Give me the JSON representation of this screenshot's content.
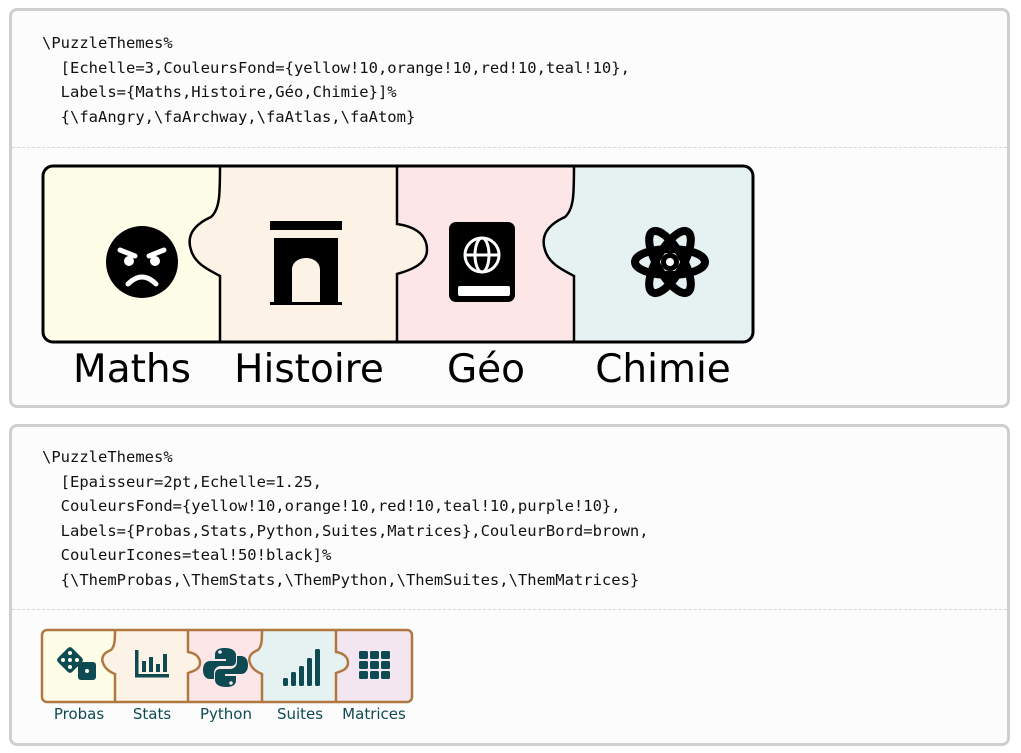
{
  "example1": {
    "code_lines": [
      "\\PuzzleThemes%",
      "  [Echelle=3,CouleursFond={yellow!10,orange!10,red!10,teal!10},",
      "  Labels={Maths,Histoire,Géo,Chimie}]%",
      "  {\\faAngry,\\faArchway,\\faAtlas,\\faAtom}"
    ],
    "pieces": [
      {
        "label": "Maths",
        "icon": "angry-face-icon",
        "fill": "#fefde8"
      },
      {
        "label": "Histoire",
        "icon": "archway-icon",
        "fill": "#fdf2e6"
      },
      {
        "label": "Géo",
        "icon": "atlas-icon",
        "fill": "#fde6e8"
      },
      {
        "label": "Chimie",
        "icon": "atom-icon",
        "fill": "#e6f2f2"
      }
    ],
    "border_color": "#000000",
    "icon_color": "#000000"
  },
  "example2": {
    "code_lines": [
      "\\PuzzleThemes%",
      "  [Epaisseur=2pt,Echelle=1.25,",
      "  CouleursFond={yellow!10,orange!10,red!10,teal!10,purple!10},",
      "  Labels={Probas,Stats,Python,Suites,Matrices},CouleurBord=brown,",
      "  CouleurIcones=teal!50!black]%",
      "  {\\ThemProbas,\\ThemStats,\\ThemPython,\\ThemSuites,\\ThemMatrices}"
    ],
    "pieces": [
      {
        "label": "Probas",
        "icon": "dice-icon",
        "fill": "#fefde8"
      },
      {
        "label": "Stats",
        "icon": "bar-chart-icon",
        "fill": "#fdf2e6"
      },
      {
        "label": "Python",
        "icon": "python-icon",
        "fill": "#fde6e8"
      },
      {
        "label": "Suites",
        "icon": "signal-bars-icon",
        "fill": "#e6f2f2"
      },
      {
        "label": "Matrices",
        "icon": "grid-icon",
        "fill": "#f4e6f0"
      }
    ],
    "border_color": "#b07840",
    "icon_color": "#0d4a52"
  }
}
